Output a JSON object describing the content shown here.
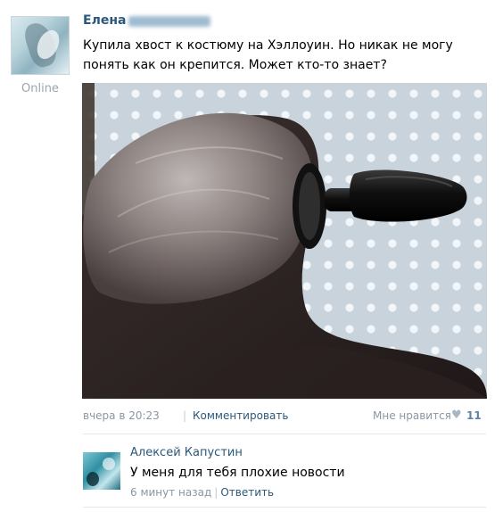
{
  "post": {
    "author_first_name": "Елена",
    "status": "Online",
    "text": "Купила хвост к костюму на Хэллоуин. Но никак не могу понять как он крепится. Может кто-то знает?",
    "timestamp": "вчера в 20:23",
    "comment_link": "Комментировать",
    "like_label": "Мне нравится",
    "like_count": "11"
  },
  "comment": {
    "author": "Алексей Капустин",
    "text": "У меня для тебя плохие новости",
    "time": "6 минут назад",
    "reply_label": "Ответить"
  },
  "icons": {
    "device": "apple-icon",
    "like": "heart-icon"
  },
  "colors": {
    "link": "#2b587a",
    "meta": "#8a96a3",
    "like_count": "#5e82a8"
  }
}
